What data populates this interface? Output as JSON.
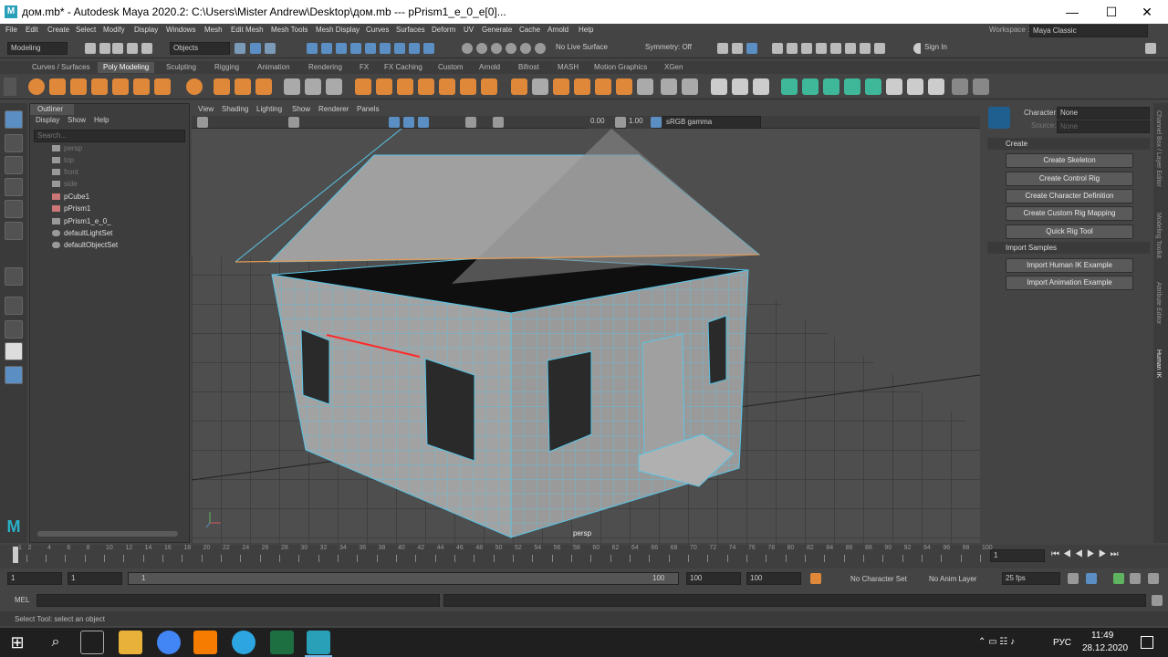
{
  "window": {
    "title": "дом.mb* - Autodesk Maya 2020.2: C:\\Users\\Mister Andrew\\Desktop\\дом.mb   ---   pPrism1_e_0_e[0]...",
    "minimize": "—",
    "maximize": "☐",
    "close": "✕"
  },
  "menu": [
    "File",
    "Edit",
    "Create",
    "Select",
    "Modify",
    "Display",
    "Windows",
    "Mesh",
    "Edit Mesh",
    "Mesh Tools",
    "Mesh Display",
    "Curves",
    "Surfaces",
    "Deform",
    "UV",
    "Generate",
    "Cache",
    "Arnold",
    "Help"
  ],
  "workspace": {
    "label": "Workspace :",
    "value": "Maya Classic"
  },
  "statusline": {
    "mode": "Modeling",
    "objects": "Objects",
    "live_surface": "No Live Surface",
    "symmetry": "Symmetry: Off",
    "sign_in": "Sign In"
  },
  "shelf_tabs": [
    "Curves / Surfaces",
    "Poly Modeling",
    "Sculpting",
    "Rigging",
    "Animation",
    "Rendering",
    "FX",
    "FX Caching",
    "Custom",
    "Arnold",
    "Bifrost",
    "MASH",
    "Motion Graphics",
    "XGen"
  ],
  "shelf_active": "Poly Modeling",
  "outliner": {
    "title": "Outliner",
    "menu": [
      "Display",
      "Show",
      "Help"
    ],
    "search_placeholder": "Search...",
    "items": [
      {
        "label": "persp",
        "dim": true
      },
      {
        "label": "top",
        "dim": true
      },
      {
        "label": "front",
        "dim": true
      },
      {
        "label": "side",
        "dim": true
      },
      {
        "label": "pCube1",
        "dim": false
      },
      {
        "label": "pPrism1",
        "dim": false
      },
      {
        "label": "pPrism1_e_0_",
        "dim": false
      },
      {
        "label": "defaultLightSet",
        "dim": false
      },
      {
        "label": "defaultObjectSet",
        "dim": false
      }
    ]
  },
  "viewport": {
    "menu": [
      "View",
      "Shading",
      "Lighting",
      "Show",
      "Renderer",
      "Panels"
    ],
    "field1": "0.00",
    "field2": "1.00",
    "colorspace": "sRGB gamma",
    "camera_label": "persp"
  },
  "hik": {
    "character_label": "Character:",
    "character_value": "None",
    "source_label": "Source:",
    "source_value": "None",
    "create_section": "Create",
    "create_buttons": [
      "Create Skeleton",
      "Create Control Rig",
      "Create Character Definition",
      "Create Custom Rig Mapping",
      "Quick Rig Tool"
    ],
    "import_section": "Import Samples",
    "import_buttons": [
      "Import Human IK Example",
      "Import Animation Example"
    ]
  },
  "side_tabs": [
    "Channel Box / Layer Editor",
    "Modeling Toolkit",
    "Attribute Editor",
    "Human IK"
  ],
  "timeline": {
    "ticks": [
      "1",
      "2",
      "4",
      "6",
      "8",
      "10",
      "12",
      "14",
      "16",
      "18",
      "20",
      "22",
      "24",
      "26",
      "28",
      "30",
      "32",
      "34",
      "36",
      "38",
      "40",
      "42",
      "44",
      "46",
      "48",
      "50",
      "52",
      "54",
      "56",
      "58",
      "60",
      "62",
      "64",
      "66",
      "68",
      "70",
      "72",
      "74",
      "76",
      "78",
      "80",
      "82",
      "84",
      "86",
      "88",
      "90",
      "92",
      "94",
      "96",
      "98",
      "100"
    ],
    "current_frame": "1"
  },
  "range": {
    "start": "1",
    "start2": "1",
    "slider_start": "1",
    "slider_end": "100",
    "end": "100",
    "end2": "100",
    "character_set": "No Character Set",
    "anim_layer": "No Anim Layer",
    "fps": "25 fps"
  },
  "command": {
    "lang": "MEL"
  },
  "help_line": "Select Tool: select an object",
  "taskbar": {
    "lang": "РУС",
    "time": "11:49",
    "date": "28.12.2020"
  }
}
